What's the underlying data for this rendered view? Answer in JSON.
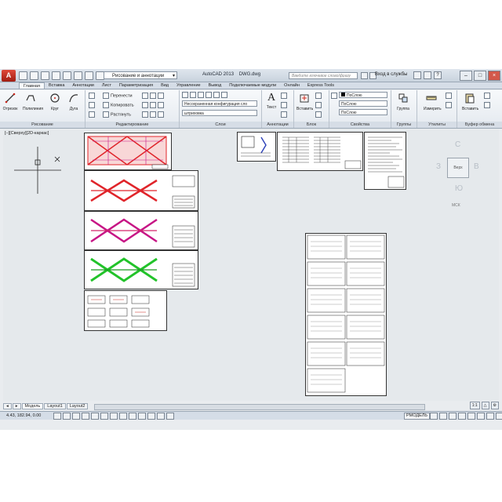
{
  "titlebar": {
    "workspace": "Рисование и аннотации",
    "app_title": "AutoCAD 2013",
    "file_name": "DWG.dwg",
    "search_placeholder": "Введите ключевое слово/фразу",
    "login": "Вход в службы"
  },
  "tabs": [
    "Главная",
    "Вставка",
    "Аннотации",
    "Лист",
    "Параметризация",
    "Вид",
    "Управление",
    "Вывод",
    "Подключаемые модули",
    "Онлайн",
    "Express Tools"
  ],
  "ribbon": {
    "draw": {
      "title": "Рисование",
      "buttons": [
        "Отрезок",
        "Полилиния",
        "Круг",
        "Дуга"
      ]
    },
    "modify": {
      "title": "Редактирование",
      "items": [
        "Перенести",
        "Копировать",
        "Растянуть"
      ]
    },
    "layers": {
      "title": "Слои",
      "state": "Несохраненная конфигурация сло",
      "layer": "штриховка"
    },
    "annotation": {
      "title": "Аннотации",
      "text": "Текст"
    },
    "block": {
      "title": "Блок",
      "insert": "Вставить"
    },
    "properties": {
      "title": "Свойства",
      "bylayer1": "ПоСлою",
      "bylayer2": "ПоСлою",
      "bylayer3": "ПоСлою"
    },
    "groups": {
      "title": "Группы",
      "label": "Группа"
    },
    "utilities": {
      "title": "Утилиты",
      "measure": "Измерить"
    },
    "clipboard": {
      "title": "Буфер обмена",
      "paste": "Вставить"
    }
  },
  "viewport": {
    "label": "[–][Сверху][2D-каркас]",
    "viewcube": {
      "face": "Верх",
      "north": "С",
      "south": "Ю",
      "west": "З",
      "east": "В",
      "wcs": "МСК"
    }
  },
  "layout_tabs": [
    "Модель",
    "Layout1",
    "Layout2"
  ],
  "status": {
    "coords": "4.43, 182.94, 0.00",
    "model": "РМОДЕЛЬ",
    "scale": "1:1"
  },
  "colors": {
    "accent_red": "#c8261a",
    "drawing_red": "#e0242a",
    "drawing_pink": "#c71585",
    "drawing_green": "#22c32a",
    "canvas_bg": "#e5e9ec"
  }
}
